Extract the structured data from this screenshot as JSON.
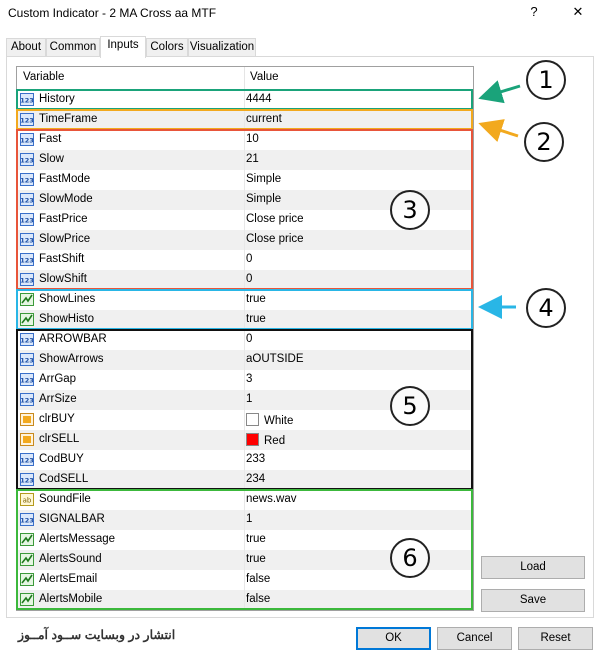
{
  "window": {
    "title": "Custom Indicator - 2 MA Cross aa MTF",
    "help": "?",
    "close": "✕"
  },
  "tabs": [
    "About",
    "Common",
    "Inputs",
    "Colors",
    "Visualization"
  ],
  "grid": {
    "col_variable": "Variable",
    "col_value": "Value",
    "rows": [
      {
        "icon": "int",
        "name": "History",
        "value": "4444"
      },
      {
        "icon": "int",
        "name": "TimeFrame",
        "value": "current"
      },
      {
        "icon": "int",
        "name": "Fast",
        "value": "10"
      },
      {
        "icon": "int",
        "name": "Slow",
        "value": "21"
      },
      {
        "icon": "int",
        "name": "FastMode",
        "value": "Simple"
      },
      {
        "icon": "int",
        "name": "SlowMode",
        "value": "Simple"
      },
      {
        "icon": "int",
        "name": "FastPrice",
        "value": "Close price"
      },
      {
        "icon": "int",
        "name": "SlowPrice",
        "value": "Close price"
      },
      {
        "icon": "int",
        "name": "FastShift",
        "value": "0"
      },
      {
        "icon": "int",
        "name": "SlowShift",
        "value": "0"
      },
      {
        "icon": "bool",
        "name": "ShowLines",
        "value": "true"
      },
      {
        "icon": "bool",
        "name": "ShowHisto",
        "value": "true"
      },
      {
        "icon": "int",
        "name": "ARROWBAR",
        "value": "0"
      },
      {
        "icon": "int",
        "name": "ShowArrows",
        "value": "aOUTSIDE"
      },
      {
        "icon": "int",
        "name": "ArrGap",
        "value": "3"
      },
      {
        "icon": "int",
        "name": "ArrSize",
        "value": "1"
      },
      {
        "icon": "color",
        "name": "clrBUY",
        "value": "White",
        "swatch": "#ffffff"
      },
      {
        "icon": "color",
        "name": "clrSELL",
        "value": "Red",
        "swatch": "#ff0000"
      },
      {
        "icon": "int",
        "name": "CodBUY",
        "value": "233"
      },
      {
        "icon": "int",
        "name": "CodSELL",
        "value": "234"
      },
      {
        "icon": "string",
        "name": "SoundFile",
        "value": "news.wav"
      },
      {
        "icon": "int",
        "name": "SIGNALBAR",
        "value": "1"
      },
      {
        "icon": "bool",
        "name": "AlertsMessage",
        "value": "true"
      },
      {
        "icon": "bool",
        "name": "AlertsSound",
        "value": "true"
      },
      {
        "icon": "bool",
        "name": "AlertsEmail",
        "value": "false"
      },
      {
        "icon": "bool",
        "name": "AlertsMobile",
        "value": "false"
      }
    ]
  },
  "annotations": [
    "1",
    "2",
    "3",
    "4",
    "5",
    "6"
  ],
  "highlight_colors": [
    "#1aa37a",
    "#f2a91e",
    "#e8553a",
    "#29b6e6",
    "#111111",
    "#3cb83c"
  ],
  "buttons": {
    "load": "Load",
    "save": "Save",
    "ok": "OK",
    "cancel": "Cancel",
    "reset": "Reset"
  },
  "footer_text": "انتشار در وبسایت ســود آمــوز"
}
